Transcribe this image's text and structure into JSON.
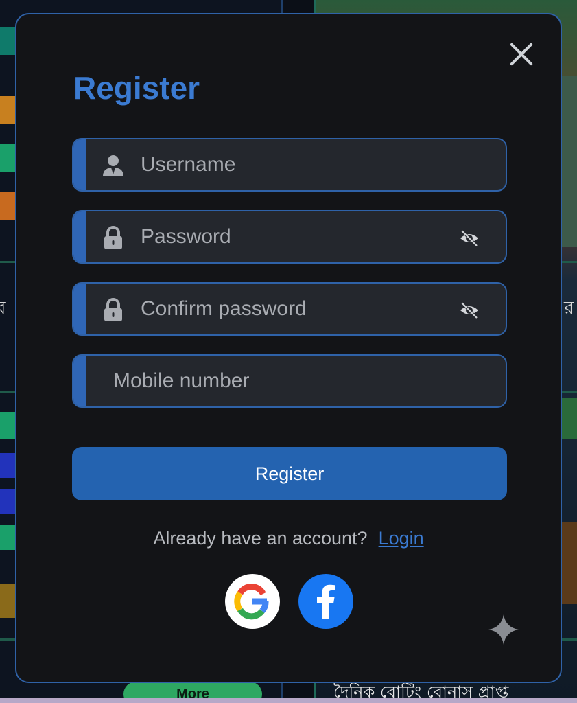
{
  "modal": {
    "title": "Register",
    "fields": {
      "username": {
        "placeholder": "Username",
        "value": ""
      },
      "password": {
        "placeholder": "Password",
        "value": ""
      },
      "confirm_password": {
        "placeholder": "Confirm password",
        "value": ""
      },
      "mobile": {
        "placeholder": "Mobile number",
        "value": ""
      }
    },
    "submit_label": "Register",
    "footer": {
      "prompt": "Already have an account?",
      "login_label": "Login"
    },
    "icons": {
      "close": "close-icon",
      "user": "user-icon",
      "lock": "lock-icon",
      "eye_off": "eye-off-icon",
      "google": "google-icon",
      "facebook": "facebook-icon",
      "sparkle": "sparkle-icon"
    }
  },
  "background": {
    "more_label": "More",
    "bottom_text": "দৈনিক বোটিং বোনাস প্রাপ্ত",
    "left_glyph": "ব",
    "right_glyph": "র"
  },
  "colors": {
    "accent": "#2f62a8",
    "title": "#3b7bd2",
    "button": "#2463b0",
    "modal_bg": "#131417",
    "field_bg": "#24272d"
  }
}
